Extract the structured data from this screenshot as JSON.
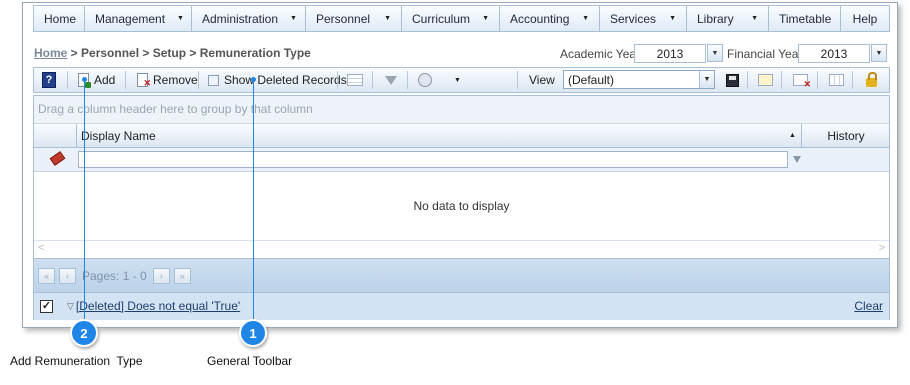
{
  "menu": [
    {
      "label": "Home",
      "caret": false
    },
    {
      "label": "Management",
      "caret": true
    },
    {
      "label": "Administration",
      "caret": true
    },
    {
      "label": "Personnel",
      "caret": true
    },
    {
      "label": "Curriculum",
      "caret": true
    },
    {
      "label": "Accounting",
      "caret": true
    },
    {
      "label": "Services",
      "caret": true
    },
    {
      "label": "Library",
      "caret": true
    },
    {
      "label": "Timetable",
      "caret": false
    },
    {
      "label": "Help",
      "caret": false
    }
  ],
  "breadcrumb": {
    "home": "Home",
    "rest": " > Personnel > Setup > Remuneration Type"
  },
  "academic_year": {
    "label": "Academic Year",
    "value": "2013"
  },
  "financial_year": {
    "label": "Financial Year",
    "value": "2013"
  },
  "toolbar": {
    "help_icon": "help-icon",
    "add_label": "Add",
    "remove_label": "Remove",
    "show_deleted_label": "Show Deleted Records",
    "view_label": "View",
    "view_value": "(Default)"
  },
  "grid": {
    "group_hint": "Drag a column header here to group by that column",
    "columns": [
      "Display Name",
      "History"
    ],
    "empty_text": "No data to display",
    "pager_text": "Pages: 1 - 0",
    "filter_text": "[Deleted] Does not equal 'True'",
    "clear_label": "Clear"
  },
  "callouts": [
    {
      "number": "1",
      "label": "General Toolbar"
    },
    {
      "number": "2",
      "label": "Add Remuneration  Type"
    }
  ],
  "colors": {
    "accent": "#1f86e6",
    "header_bg": "#dce7f3",
    "border": "#a9bfd6"
  }
}
